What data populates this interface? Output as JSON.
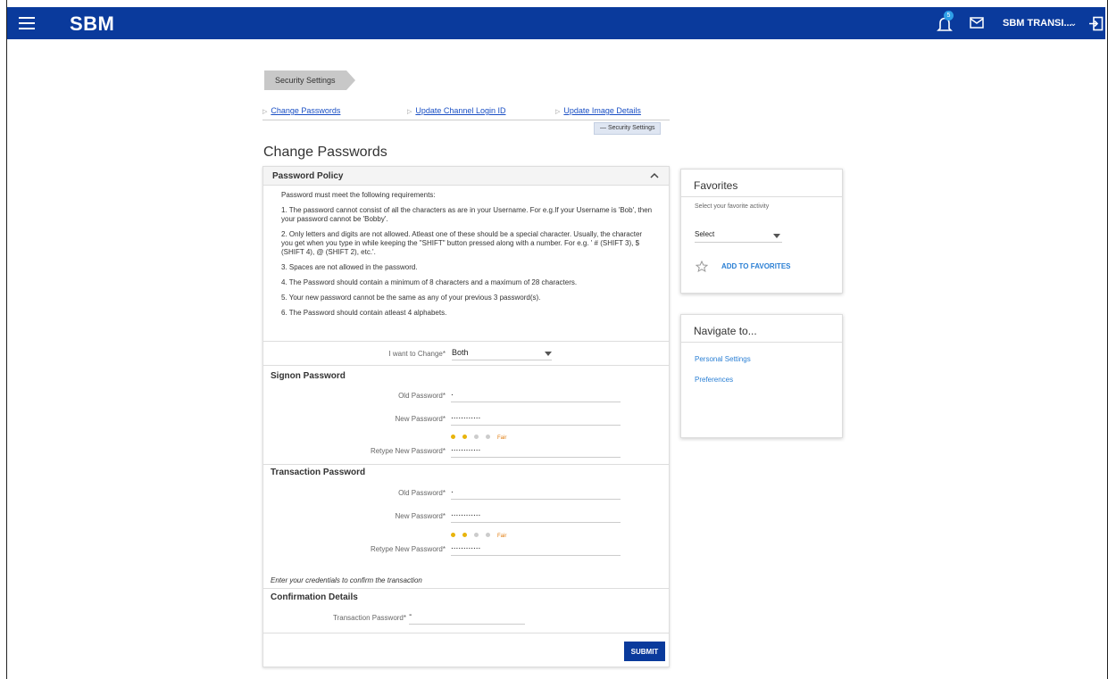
{
  "header": {
    "logo": "SBM",
    "notification_count": "5",
    "user_name": "SBM TRANSI...",
    "brand_color": "#0a3a9c"
  },
  "breadcrumb": [
    "Security Settings"
  ],
  "sublinks": [
    "Change Passwords",
    "Update Channel Login ID",
    "Update Image Details"
  ],
  "section_tag": "Security Settings",
  "page_title": "Change Passwords",
  "policy": {
    "title": "Password Policy",
    "intro": "Password must meet the following requirements:",
    "rules": [
      "1. The password cannot consist of all the characters as are in your Username. For e.g.If your Username is 'Bob', then your password cannot be 'Bobby'.",
      "2. Only letters and digits are not allowed. Atleast one of these should be a special character. Usually, the character you get when you type in while keeping the \"SHIFT\" button pressed along with a number. For e.g. ' # (SHIFT 3), $ (SHIFT 4), @ (SHIFT 2), etc.'.",
      "3. Spaces are not allowed in the password.",
      "4. The Password should contain a minimum of 8 characters and a maximum of 28 characters.",
      "5. Your new password cannot be the same as any of your previous 3 password(s).",
      "6. The Password should contain atleast 4 alphabets."
    ]
  },
  "want_to_change": {
    "label": "I want to Change*",
    "value": "Both"
  },
  "signon": {
    "title": "Signon Password",
    "old_label": "Old Password*",
    "old_value": ".",
    "new_label": "New Password*",
    "new_value": "............",
    "strength": "Fair",
    "strength_level": 2,
    "retype_label": "Retype New Password*",
    "retype_value": "............"
  },
  "transaction": {
    "title": "Transaction Password",
    "old_label": "Old Password*",
    "old_value": ".",
    "new_label": "New Password*",
    "new_value": "............",
    "strength": "Fair",
    "strength_level": 2,
    "retype_label": "Retype New Password*",
    "retype_value": "............"
  },
  "confirm_note": "Enter your credentials to confirm the transaction",
  "confirmation": {
    "title": "Confirmation Details",
    "label": "Transaction Password*",
    "value": "-"
  },
  "submit_label": "SUBMIT",
  "favorites": {
    "title": "Favorites",
    "hint": "Select your favorite activity",
    "select_value": "Select",
    "add_label": "ADD TO FAVORITES"
  },
  "navigate": {
    "title": "Navigate to...",
    "links": [
      "Personal Settings",
      "Preferences"
    ]
  }
}
